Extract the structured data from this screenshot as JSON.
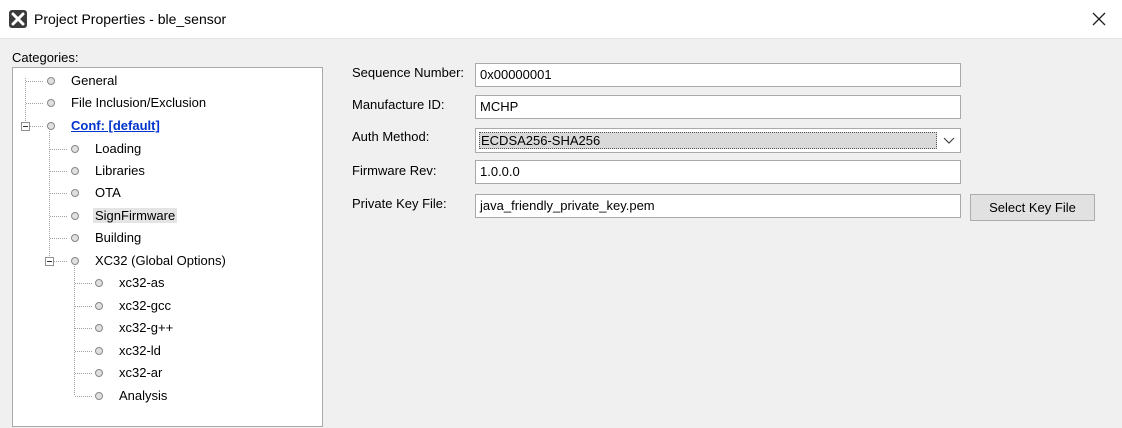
{
  "window": {
    "title": "Project Properties - ble_sensor"
  },
  "categories_label": "Categories:",
  "tree": {
    "general": "General",
    "file_incl": "File Inclusion/Exclusion",
    "conf": "Conf: [default]",
    "loading": "Loading",
    "libraries": "Libraries",
    "ota": "OTA",
    "signfirmware": "SignFirmware",
    "building": "Building",
    "xc32": "XC32 (Global Options)",
    "xc32_as": "xc32-as",
    "xc32_gcc": "xc32-gcc",
    "xc32_gpp": "xc32-g++",
    "xc32_ld": "xc32-ld",
    "xc32_ar": "xc32-ar",
    "analysis": "Analysis"
  },
  "form": {
    "seq_label": "Sequence Number:",
    "seq_value": "0x00000001",
    "mfr_label": "Manufacture ID:",
    "mfr_value": "MCHP",
    "auth_label": "Auth Method:",
    "auth_value": "ECDSA256-SHA256",
    "fw_label": "Firmware Rev:",
    "fw_value": "1.0.0.0",
    "key_label": "Private Key File:",
    "key_value": "java_friendly_private_key.pem",
    "select_key_button": "Select Key File"
  },
  "icons": {
    "app": "app-logo-icon",
    "close": "close-icon",
    "dropdown": "chevron-down-icon"
  }
}
